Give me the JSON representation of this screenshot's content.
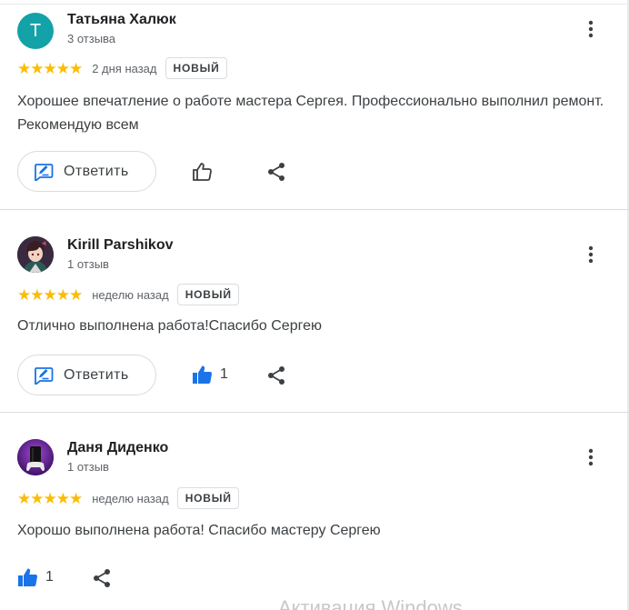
{
  "colors": {
    "star": "#fbbc04",
    "avatar_letter_bg": "#12a2a8",
    "like_active": "#1a73e8",
    "text": "#3c4043",
    "muted": "#5f6368"
  },
  "reviews": [
    {
      "avatar": {
        "type": "letter",
        "letter": "Т"
      },
      "name": "Татьяна Халюк",
      "review_count": "3 отзыва",
      "stars": "★★★★★",
      "date": "2 дня назад",
      "badge": "НОВЫЙ",
      "text": "Хорошее впечатление о работе мастера Сергея. Профессионально выполнил ремонт. Рекомендую всем",
      "reply_label": "Ответить",
      "like_count": "",
      "like_icon": "thumb-up-outline-icon"
    },
    {
      "avatar": {
        "type": "image",
        "icon": "anime-avatar"
      },
      "name": "Kirill Parshikov",
      "review_count": "1 отзыв",
      "stars": "★★★★★",
      "date": "неделю назад",
      "badge": "НОВЫЙ",
      "text": "Отлично выполнена работа!Спасибо Сергею",
      "reply_label": "Ответить",
      "like_count": "1",
      "like_icon": "thumb-up-filled-icon"
    },
    {
      "avatar": {
        "type": "image",
        "icon": "console-avatar"
      },
      "name": "Даня Диденко",
      "review_count": "1 отзыв",
      "stars": "★★★★★",
      "date": "неделю назад",
      "badge": "НОВЫЙ",
      "text": "Хорошо выполнена работа! Спасибо мастеру Сергею",
      "like_count": "1",
      "like_icon": "thumb-up-filled-icon"
    }
  ],
  "watermark": "Активация Windows"
}
